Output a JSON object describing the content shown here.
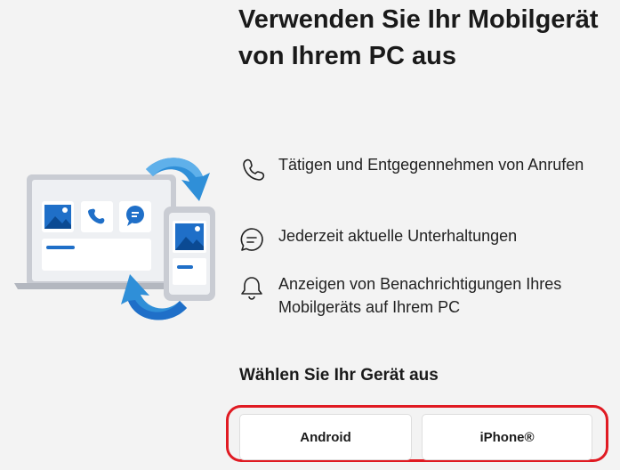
{
  "title": "Verwenden Sie Ihr Mobilgerät von Ihrem PC aus",
  "features": [
    {
      "icon": "phone-icon",
      "text": "Tätigen und Entgegennehmen von Anrufen"
    },
    {
      "icon": "chat-icon",
      "text": "Jederzeit aktuelle Unterhaltungen"
    },
    {
      "icon": "bell-icon",
      "text": "Anzeigen von Benachrichtigungen Ihres Mobilgeräts auf Ihrem PC"
    }
  ],
  "device_selection": {
    "heading": "Wählen Sie Ihr Gerät aus",
    "android_label": "Android",
    "iphone_label": "iPhone®"
  },
  "colors": {
    "accent_blue": "#1a74d0",
    "arrow_blue": "#2f8fd8",
    "highlight_red": "#e01a22",
    "background": "#f3f3f3"
  }
}
